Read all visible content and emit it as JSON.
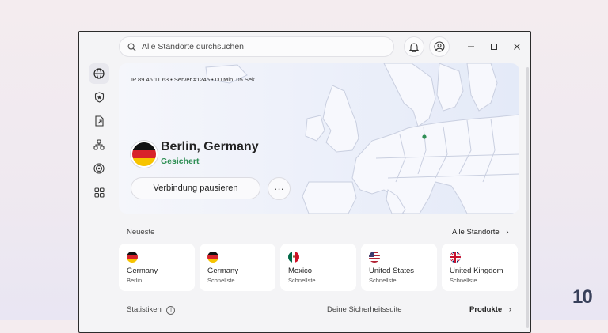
{
  "search": {
    "placeholder": "Alle Standorte durchsuchen"
  },
  "connection": {
    "ip_line": "IP 89.46.11.63 • Server #1245 • 00 Min. 05 Sek.",
    "location": "Berlin, Germany",
    "status": "Gesichert",
    "pause_label": "Verbindung pausieren",
    "more_label": "···"
  },
  "recent": {
    "label": "Neueste",
    "all_link": "Alle Standorte",
    "items": [
      {
        "country": "Germany",
        "sub": "Berlin",
        "flag": "de"
      },
      {
        "country": "Germany",
        "sub": "Schnellste",
        "flag": "de"
      },
      {
        "country": "Mexico",
        "sub": "Schnellste",
        "flag": "mx"
      },
      {
        "country": "United States",
        "sub": "Schnellste",
        "flag": "us"
      },
      {
        "country": "United Kingdom",
        "sub": "Schnellste",
        "flag": "uk"
      }
    ]
  },
  "footer": {
    "stats_label": "Statistiken",
    "suite_label": "Deine Sicherheitssuite",
    "products_label": "Produkte"
  },
  "brand": {
    "text": "10"
  },
  "colors": {
    "accent_green": "#2f8f55",
    "map_land": "#f7f8fd",
    "map_border": "#c9cfe0"
  }
}
